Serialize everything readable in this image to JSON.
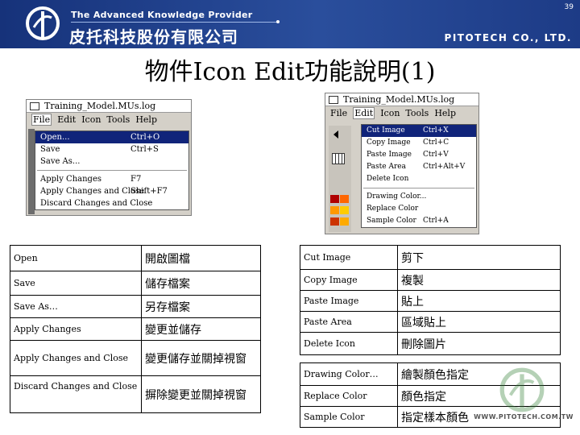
{
  "header": {
    "tagline": "The Advanced Knowledge Provider",
    "company_cn": "皮托科技股份有限公司",
    "company_en": "PITOTECH CO., LTD.",
    "slide_number": "39",
    "brand_color": "#1f3f8a"
  },
  "title": "物件Icon Edit功能說明(1)",
  "file_window": {
    "title": "Training_Model.MUs.log",
    "menus": [
      "File",
      "Edit",
      "Icon",
      "Tools",
      "Help"
    ],
    "active_menu": "File",
    "items": [
      {
        "label": "Open...",
        "shortcut": "Ctrl+O",
        "highlighted": true
      },
      {
        "label": "Save",
        "shortcut": "Ctrl+S",
        "highlighted": false
      },
      {
        "label": "Save As...",
        "shortcut": "",
        "highlighted": false
      },
      {
        "label": "Apply Changes",
        "shortcut": "F7",
        "highlighted": false
      },
      {
        "label": "Apply Changes and Close",
        "shortcut": "Shift+F7",
        "highlighted": false
      },
      {
        "label": "Discard Changes and Close",
        "shortcut": "",
        "highlighted": false
      }
    ]
  },
  "edit_window": {
    "title": "Training_Model.MUs.log",
    "menus": [
      "File",
      "Edit",
      "Icon",
      "Tools",
      "Help"
    ],
    "active_menu": "Edit",
    "items": [
      {
        "label": "Cut Image",
        "shortcut": "Ctrl+X",
        "highlighted": true
      },
      {
        "label": "Copy Image",
        "shortcut": "Ctrl+C",
        "highlighted": false
      },
      {
        "label": "Paste Image",
        "shortcut": "Ctrl+V",
        "highlighted": false
      },
      {
        "label": "Paste Area",
        "shortcut": "Ctrl+Alt+V",
        "highlighted": false
      },
      {
        "label": "Delete Icon",
        "shortcut": "",
        "highlighted": false
      },
      {
        "label": "Drawing Color...",
        "shortcut": "",
        "highlighted": false
      },
      {
        "label": "Replace Color",
        "shortcut": "",
        "highlighted": false
      },
      {
        "label": "Sample Color",
        "shortcut": "Ctrl+A",
        "highlighted": false
      }
    ],
    "palette_colors": [
      "#b00000",
      "#ff6600",
      "#ff9900",
      "#ffcc00",
      "#cc3300",
      "#ffaa00"
    ]
  },
  "file_table": [
    {
      "en": "Open",
      "cn": "開啟圖檔"
    },
    {
      "en": "Save",
      "cn": "儲存檔案"
    },
    {
      "en": "Save As…",
      "cn": "另存檔案"
    },
    {
      "en": "Apply Changes",
      "cn": "變更並儲存"
    },
    {
      "en": "Apply Changes and Close",
      "cn": "變更儲存並關掉視窗"
    },
    {
      "en": "Discard Changes and Close",
      "cn": "摒除變更並關掉視窗"
    }
  ],
  "edit_table_a": [
    {
      "en": "Cut Image",
      "cn": "剪下"
    },
    {
      "en": "Copy Image",
      "cn": "複製"
    },
    {
      "en": "Paste Image",
      "cn": "貼上"
    },
    {
      "en": "Paste Area",
      "cn": "區域貼上"
    },
    {
      "en": "Delete Icon",
      "cn": "刪除圖片"
    }
  ],
  "edit_table_b": [
    {
      "en": "Drawing Color…",
      "cn": "繪製顏色指定"
    },
    {
      "en": "Replace Color",
      "cn": "顏色指定"
    },
    {
      "en": "Sample Color",
      "cn": "指定樣本顏色"
    }
  ],
  "watermark_url": "WWW.PITOTECH.COM.TW"
}
